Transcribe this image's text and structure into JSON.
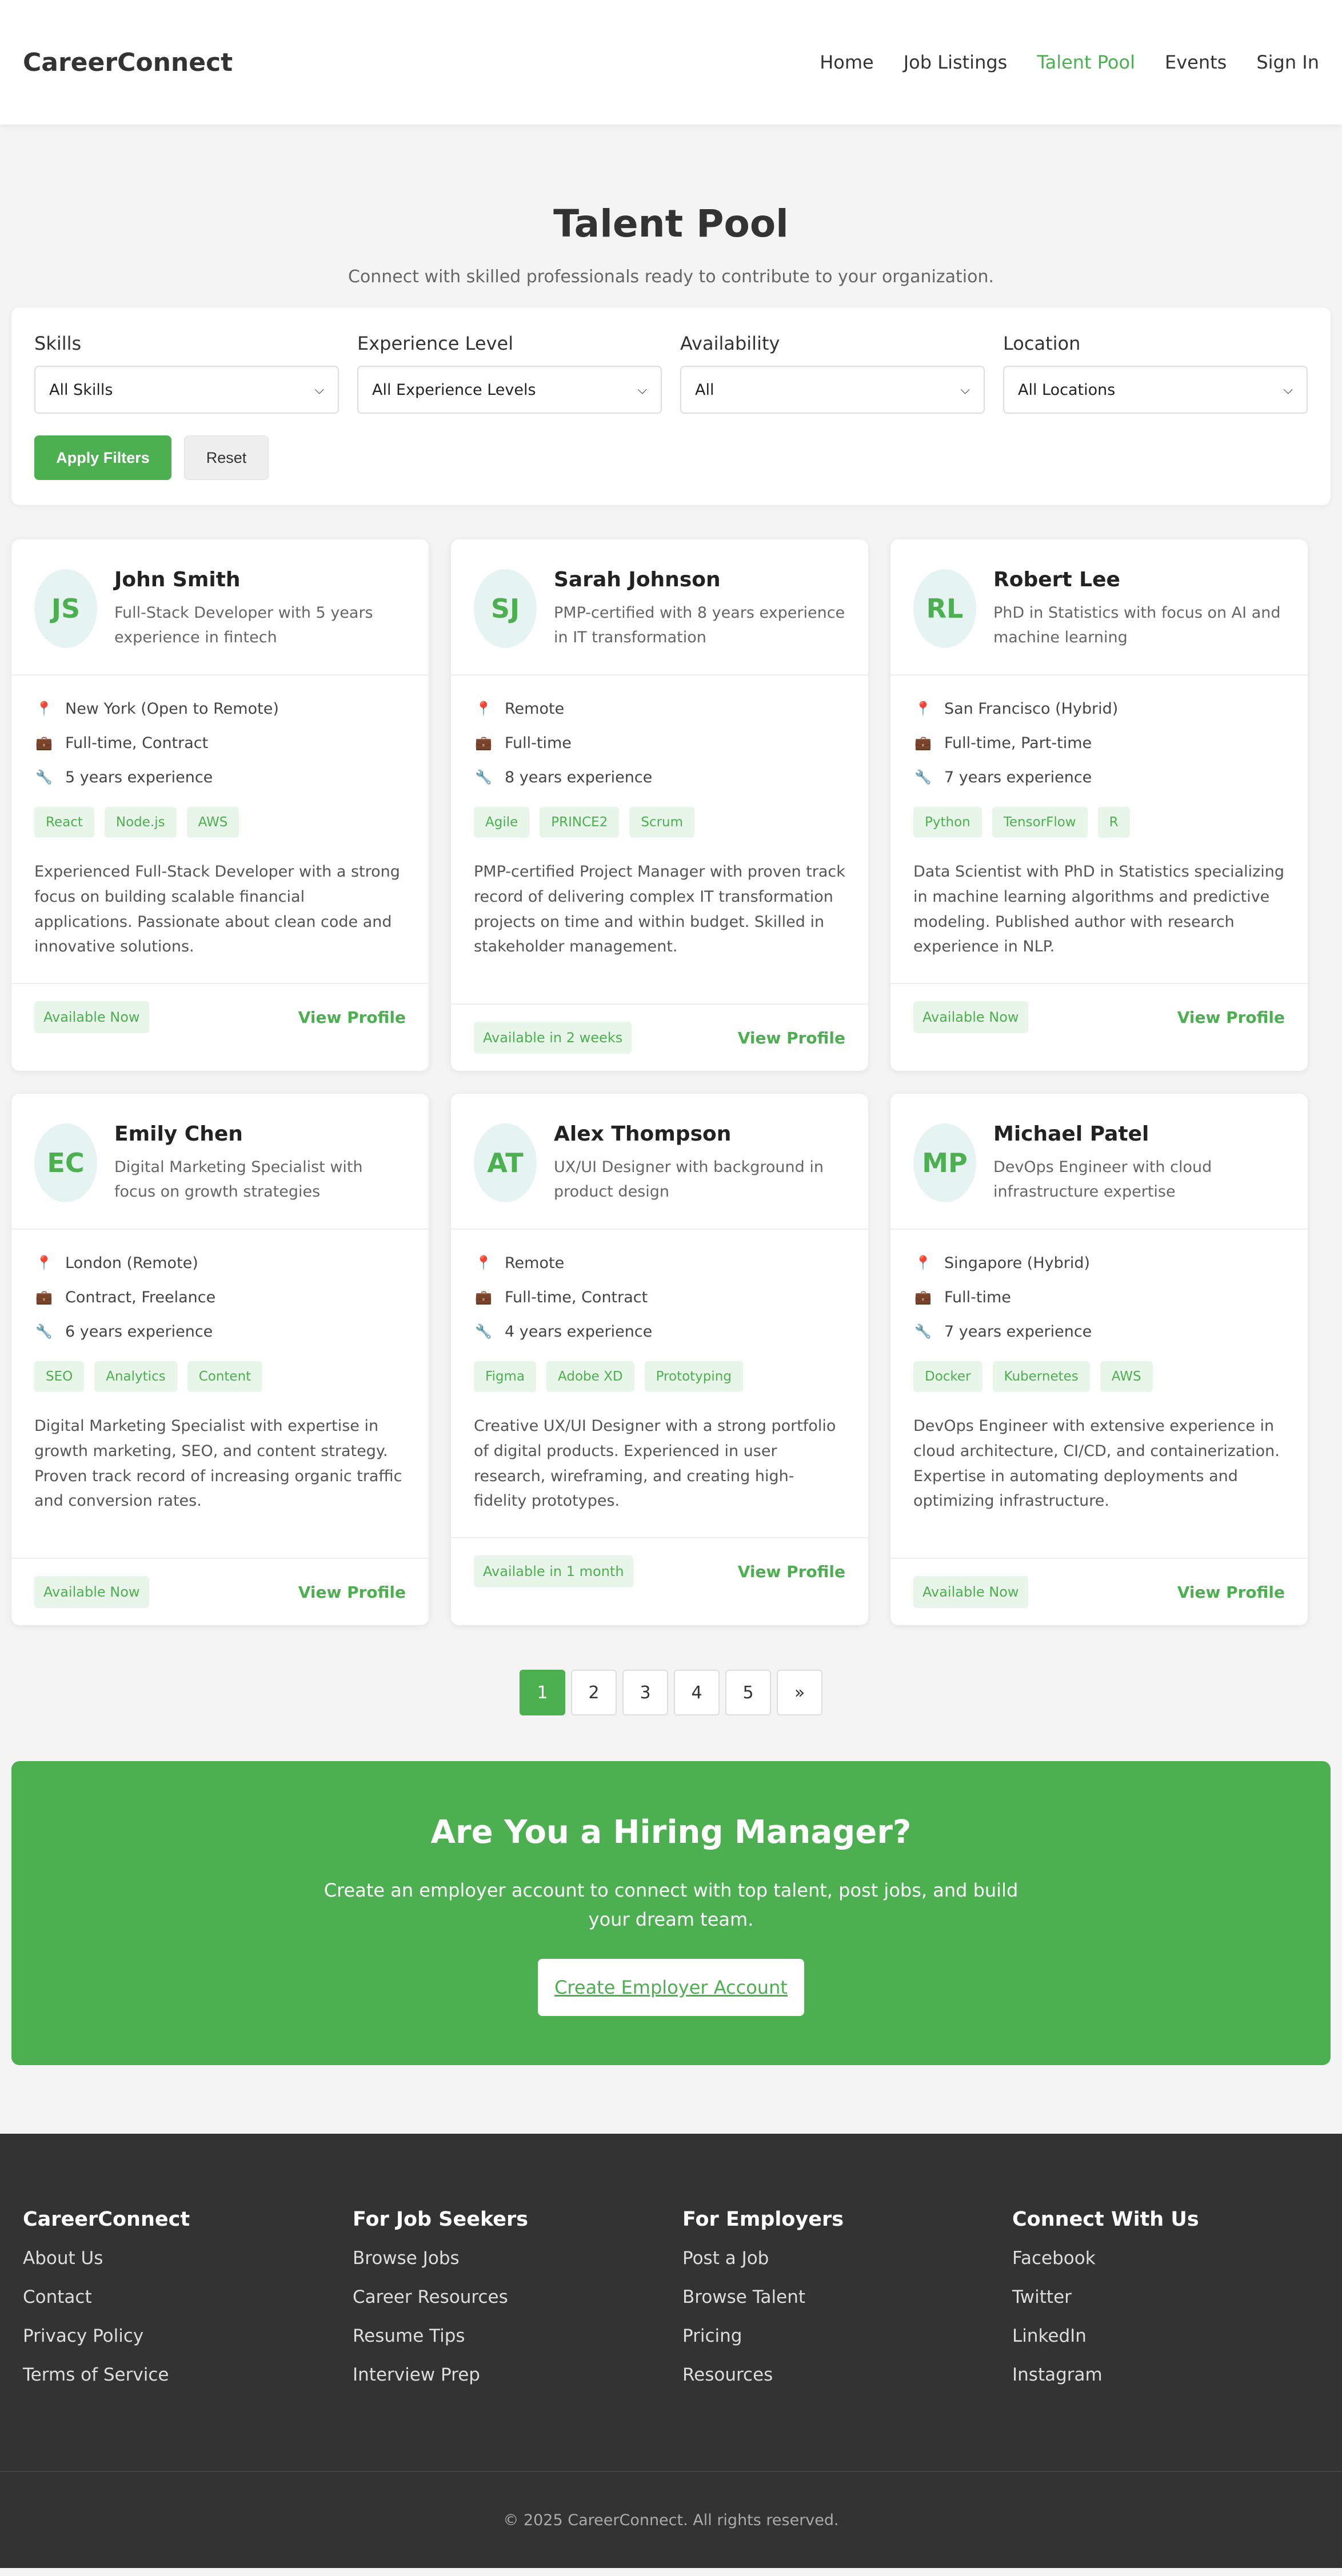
{
  "header": {
    "logo": "CareerConnect",
    "nav": [
      "Home",
      "Job Listings",
      "Talent Pool",
      "Events",
      "Sign In"
    ],
    "active_nav": "Talent Pool"
  },
  "hero": {
    "title": "Talent Pool",
    "subtitle": "Connect with skilled professionals ready to contribute to your organization."
  },
  "filters": {
    "skills": {
      "label": "Skills",
      "value": "All Skills"
    },
    "experience": {
      "label": "Experience Level",
      "value": "All Experience Levels"
    },
    "availability": {
      "label": "Availability",
      "value": "All"
    },
    "location": {
      "label": "Location",
      "value": "All Locations"
    },
    "apply_label": "Apply Filters",
    "reset_label": "Reset"
  },
  "candidates": [
    {
      "initials": "JS",
      "name": "John Smith",
      "headline": "Full-Stack Developer with 5 years experience in fintech",
      "location": "New York (Open to Remote)",
      "type": "Full-time, Contract",
      "experience": "5 years experience",
      "skills": [
        "React",
        "Node.js",
        "AWS"
      ],
      "bio": "Experienced Full-Stack Developer with a strong focus on building scalable financial applications. Passionate about clean code and innovative solutions.",
      "availability": "Available Now",
      "action": "View Profile"
    },
    {
      "initials": "SJ",
      "name": "Sarah Johnson",
      "headline": "PMP-certified with 8 years experience in IT transformation",
      "location": "Remote",
      "type": "Full-time",
      "experience": "8 years experience",
      "skills": [
        "Agile",
        "PRINCE2",
        "Scrum"
      ],
      "bio": "PMP-certified Project Manager with proven track record of delivering complex IT transformation projects on time and within budget. Skilled in stakeholder management.",
      "availability": "Available in 2 weeks",
      "action": "View Profile"
    },
    {
      "initials": "RL",
      "name": "Robert Lee",
      "headline": "PhD in Statistics with focus on AI and machine learning",
      "location": "San Francisco (Hybrid)",
      "type": "Full-time, Part-time",
      "experience": "7 years experience",
      "skills": [
        "Python",
        "TensorFlow",
        "R"
      ],
      "bio": "Data Scientist with PhD in Statistics specializing in machine learning algorithms and predictive modeling. Published author with research experience in NLP.",
      "availability": "Available Now",
      "action": "View Profile"
    },
    {
      "initials": "EC",
      "name": "Emily Chen",
      "headline": "Digital Marketing Specialist with focus on growth strategies",
      "location": "London (Remote)",
      "type": "Contract, Freelance",
      "experience": "6 years experience",
      "skills": [
        "SEO",
        "Analytics",
        "Content"
      ],
      "bio": "Digital Marketing Specialist with expertise in growth marketing, SEO, and content strategy. Proven track record of increasing organic traffic and conversion rates.",
      "availability": "Available Now",
      "action": "View Profile"
    },
    {
      "initials": "AT",
      "name": "Alex Thompson",
      "headline": "UX/UI Designer with background in product design",
      "location": "Remote",
      "type": "Full-time, Contract",
      "experience": "4 years experience",
      "skills": [
        "Figma",
        "Adobe XD",
        "Prototyping"
      ],
      "bio": "Creative UX/UI Designer with a strong portfolio of digital products. Experienced in user research, wireframing, and creating high-fidelity prototypes.",
      "availability": "Available in 1 month",
      "action": "View Profile"
    },
    {
      "initials": "MP",
      "name": "Michael Patel",
      "headline": "DevOps Engineer with cloud infrastructure expertise",
      "location": "Singapore (Hybrid)",
      "type": "Full-time",
      "experience": "7 years experience",
      "skills": [
        "Docker",
        "Kubernetes",
        "AWS"
      ],
      "bio": "DevOps Engineer with extensive experience in cloud architecture, CI/CD, and containerization. Expertise in automating deployments and optimizing infrastructure.",
      "availability": "Available Now",
      "action": "View Profile"
    }
  ],
  "pagination": [
    "1",
    "2",
    "3",
    "4",
    "5",
    "»"
  ],
  "cta": {
    "title": "Are You a Hiring Manager?",
    "text": "Create an employer account to connect with top talent, post jobs, and build your dream team.",
    "button": "Create Employer Account"
  },
  "footer": {
    "columns": [
      {
        "title": "CareerConnect",
        "links": [
          "About Us",
          "Contact",
          "Privacy Policy",
          "Terms of Service"
        ]
      },
      {
        "title": "For Job Seekers",
        "links": [
          "Browse Jobs",
          "Career Resources",
          "Resume Tips",
          "Interview Prep"
        ]
      },
      {
        "title": "For Employers",
        "links": [
          "Post a Job",
          "Browse Talent",
          "Pricing",
          "Resources"
        ]
      },
      {
        "title": "Connect With Us",
        "links": [
          "Facebook",
          "Twitter",
          "LinkedIn",
          "Instagram"
        ]
      }
    ],
    "copyright": "© 2025 CareerConnect. All rights reserved."
  },
  "colors": {
    "accent": "#4caf50",
    "footer_bg": "#333333",
    "page_bg": "#f4f4f4"
  },
  "icons": {
    "location": "pin-icon",
    "type": "briefcase-icon",
    "experience": "wrench-icon",
    "select": "chevron-down-icon"
  }
}
